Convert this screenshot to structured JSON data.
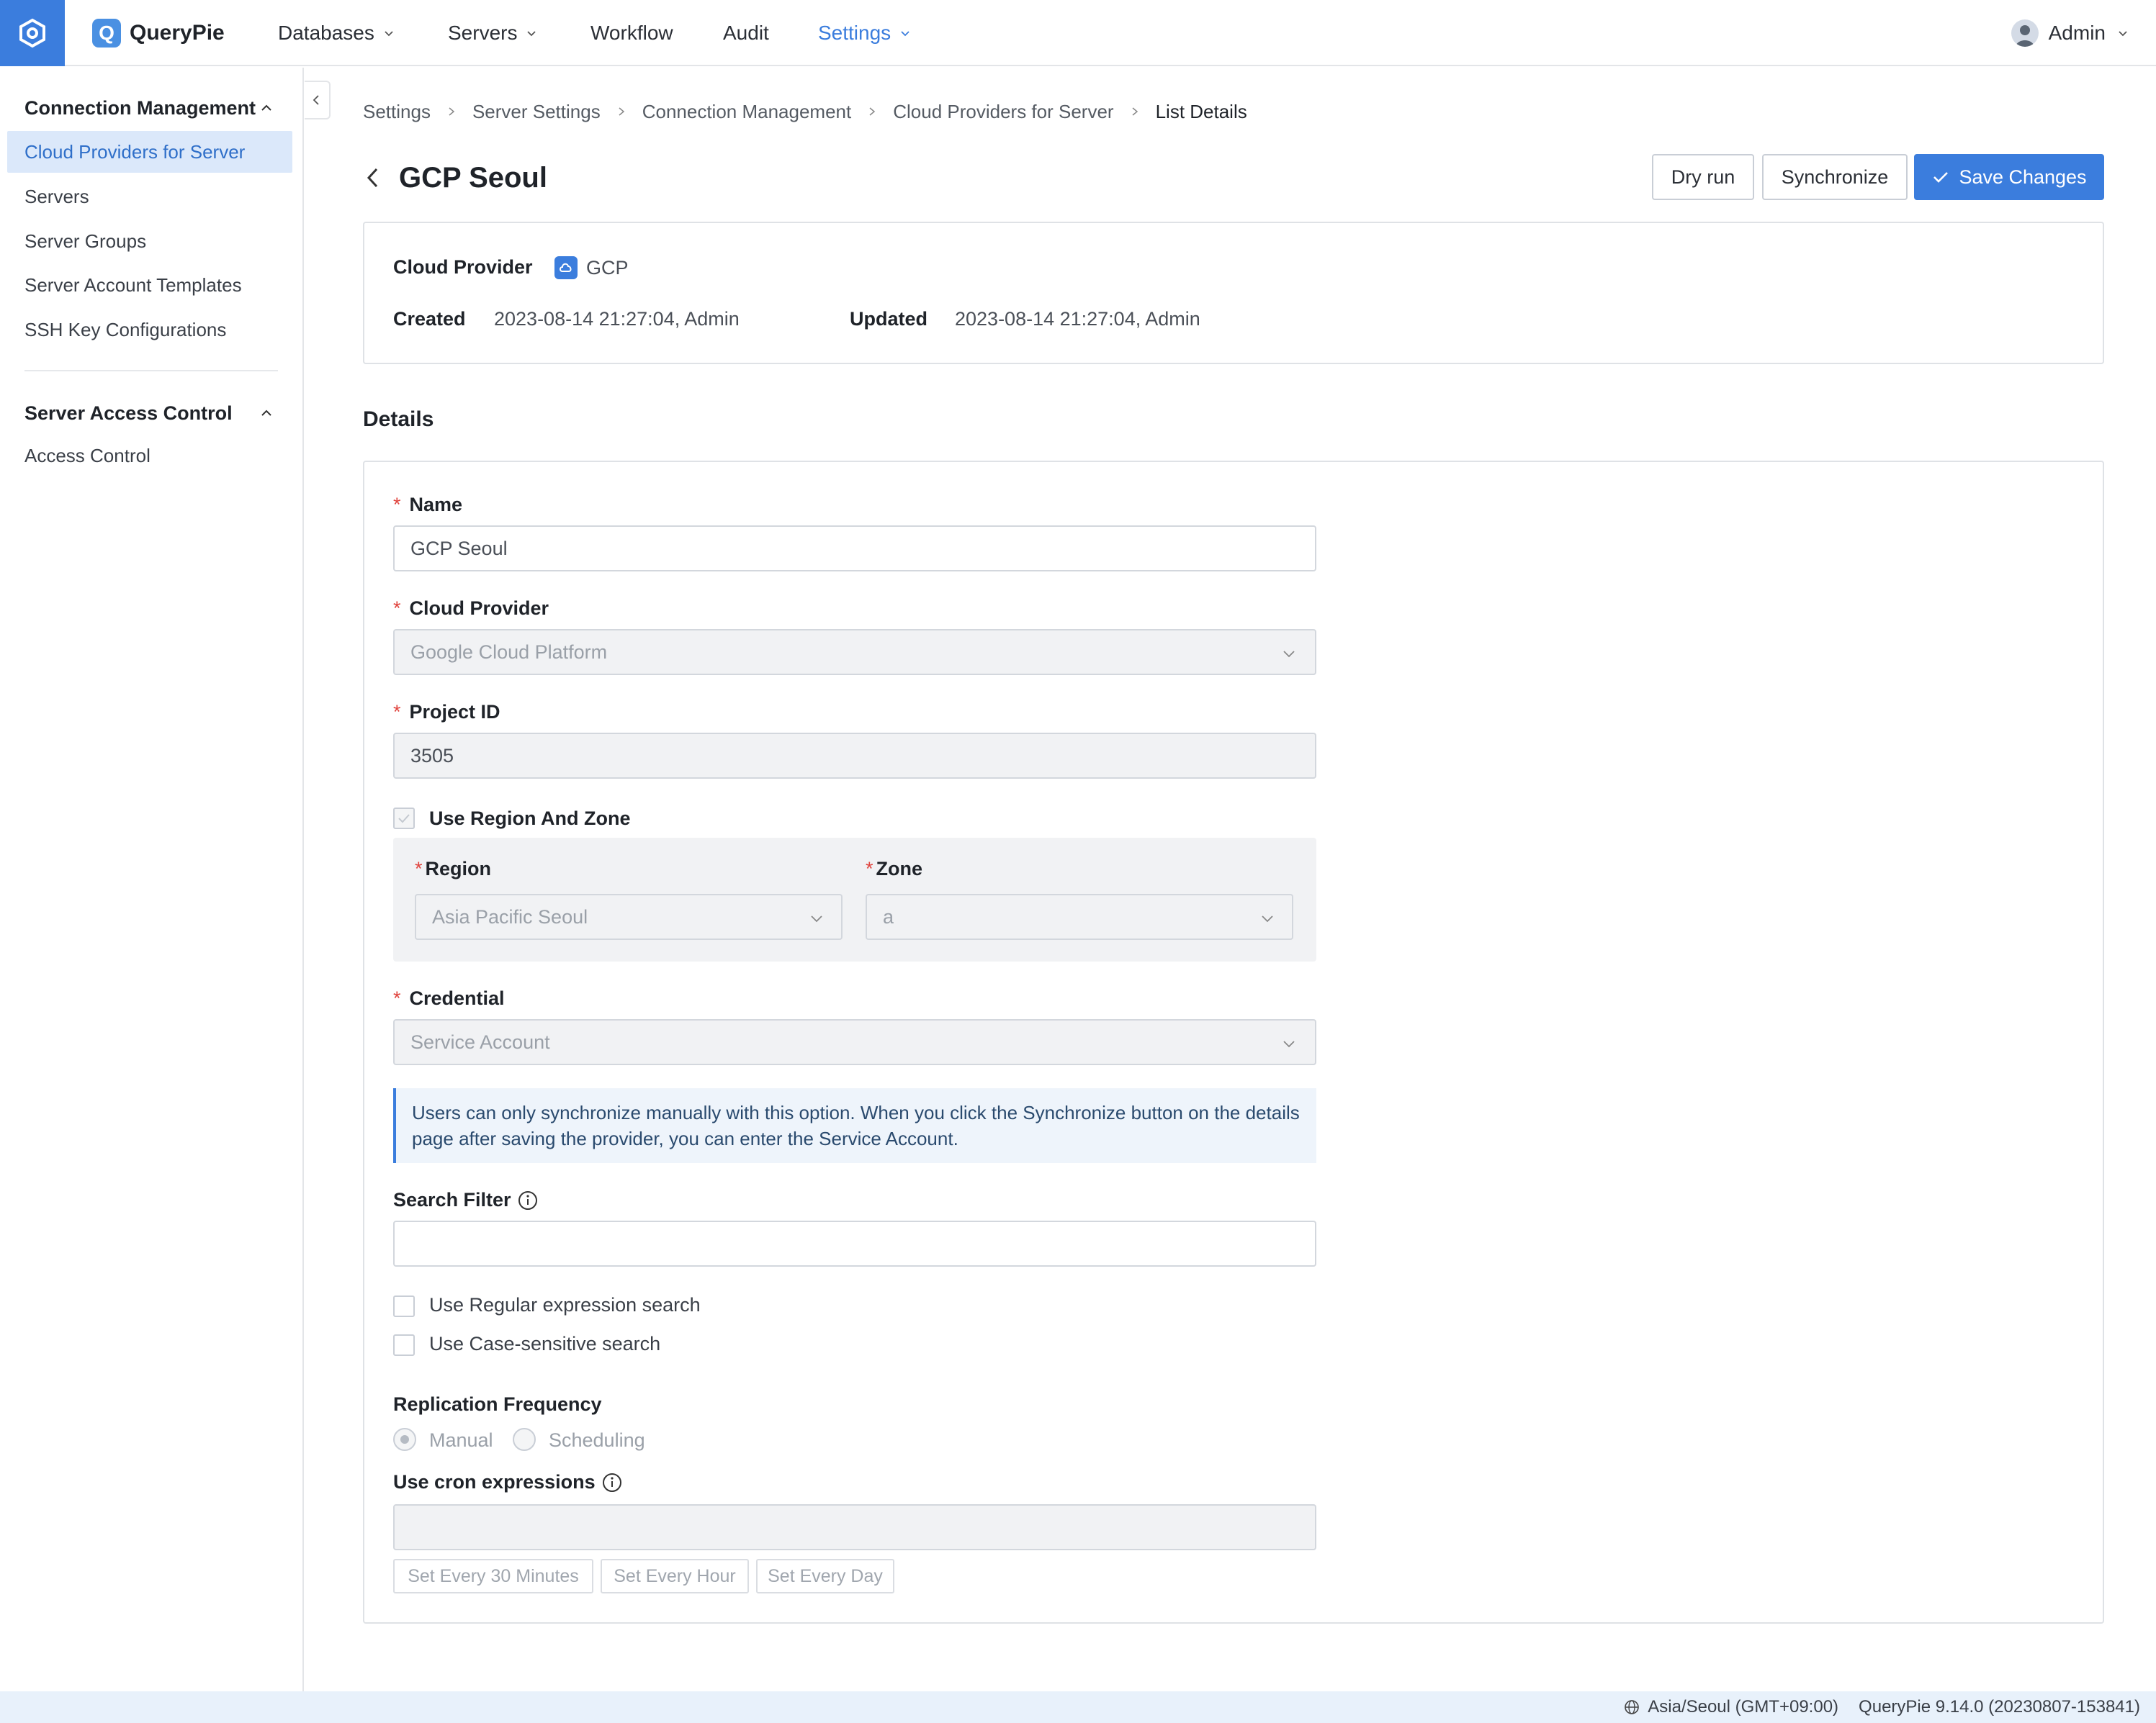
{
  "header": {
    "brand": "QueryPie",
    "nav": [
      {
        "label": "Databases",
        "has_dropdown": true,
        "active": false
      },
      {
        "label": "Servers",
        "has_dropdown": true,
        "active": false
      },
      {
        "label": "Workflow",
        "has_dropdown": false,
        "active": false
      },
      {
        "label": "Audit",
        "has_dropdown": false,
        "active": false
      },
      {
        "label": "Settings",
        "has_dropdown": true,
        "active": true
      }
    ],
    "user": "Admin",
    "accent_color": "#3b7ddd"
  },
  "sidebar": {
    "groups": [
      {
        "title": "Connection Management",
        "items": [
          "Cloud Providers for Server",
          "Servers",
          "Server Groups",
          "Server Account Templates",
          "SSH Key Configurations"
        ]
      },
      {
        "title": "Server Access Control",
        "items": [
          "Access Control"
        ]
      }
    ],
    "active_item": "Cloud Providers for Server"
  },
  "breadcrumb": [
    "Settings",
    "Server Settings",
    "Connection Management",
    "Cloud Providers for Server",
    "List Details"
  ],
  "page": {
    "title": "GCP Seoul",
    "buttons": {
      "dry_run": "Dry run",
      "synchronize": "Synchronize",
      "save": "Save Changes"
    }
  },
  "info": {
    "cloud_provider_label": "Cloud Provider",
    "cloud_provider_value": "GCP",
    "created_label": "Created",
    "created_value": "2023-08-14 21:27:04, Admin",
    "updated_label": "Updated",
    "updated_value": "2023-08-14 21:27:04, Admin"
  },
  "details": {
    "section_title": "Details",
    "name_label": "Name",
    "name_value": "GCP Seoul",
    "cloud_provider_label": "Cloud Provider",
    "cloud_provider_value": "Google Cloud Platform",
    "project_id_label": "Project ID",
    "project_id_value": "3505",
    "use_region_zone_label": "Use Region And Zone",
    "use_region_zone_checked": true,
    "region_label": "Region",
    "region_value": "Asia Pacific Seoul",
    "zone_label": "Zone",
    "zone_value": "a",
    "credential_label": "Credential",
    "credential_value": "Service Account",
    "notice": "Users can only synchronize manually with this option. When you click the Synchronize button on the details page after saving the provider, you can enter the Service Account.",
    "search_filter_label": "Search Filter",
    "search_filter_value": "",
    "regex_label": "Use Regular expression search",
    "case_label": "Use Case-sensitive search",
    "replication_label": "Replication Frequency",
    "replication_options": [
      "Manual",
      "Scheduling"
    ],
    "replication_selected": "Manual",
    "cron_label": "Use cron expressions",
    "cron_value": "",
    "presets": [
      "Set Every 30 Minutes",
      "Set Every Hour",
      "Set Every Day"
    ]
  },
  "footer": {
    "timezone": "Asia/Seoul (GMT+09:00)",
    "version": "QueryPie 9.14.0 (20230807-153841)"
  }
}
